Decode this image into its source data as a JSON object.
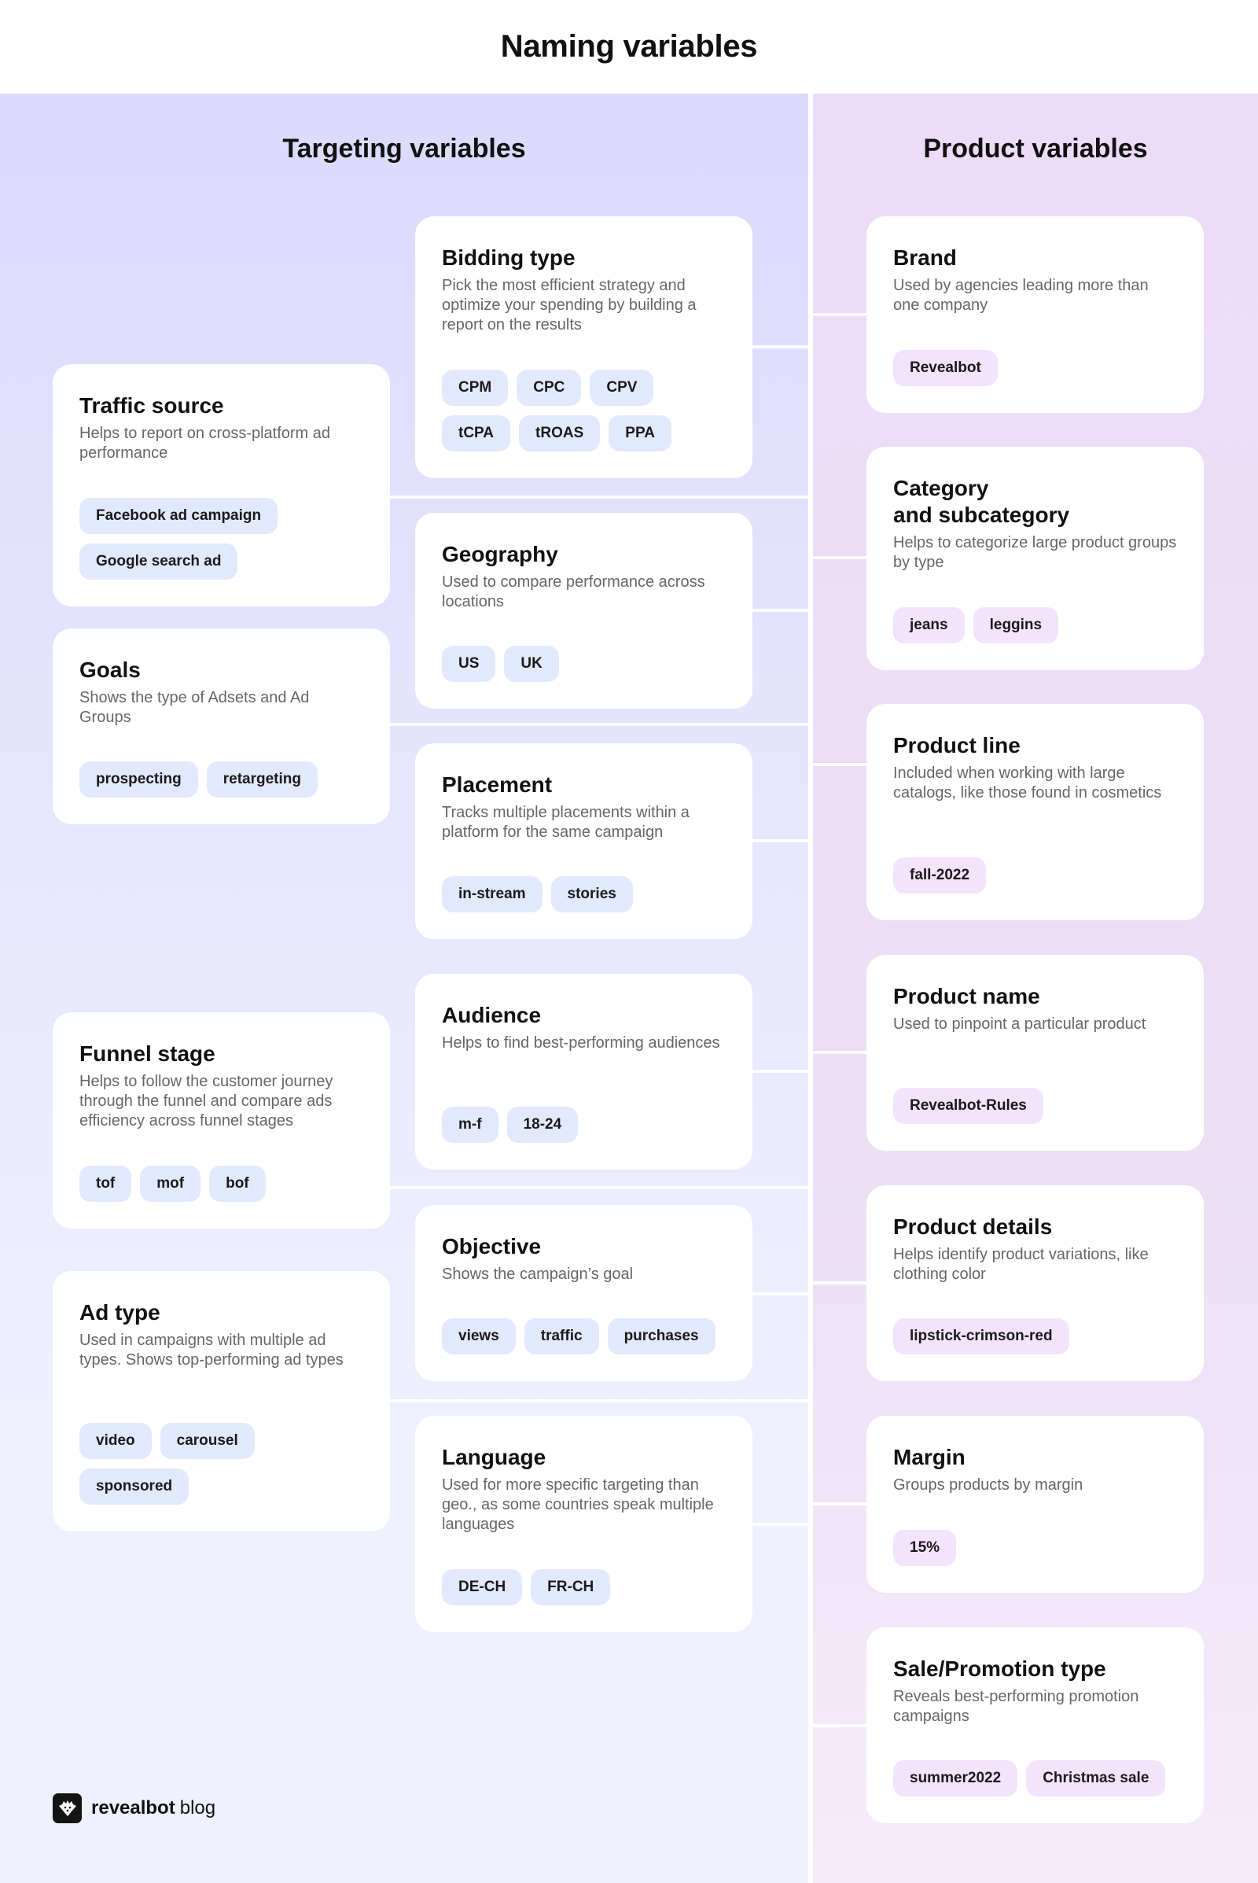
{
  "title": "Naming variables",
  "targeting": {
    "title": "Targeting variables",
    "cards": [
      {
        "title": "Bidding type",
        "desc": "Pick the most efficient strategy and optimize your spending by building a report on the results",
        "tags": [
          "CPM",
          "CPC",
          "CPV",
          "tCPA",
          "tROAS",
          "PPA"
        ]
      },
      {
        "title": "Traffic source",
        "desc": "Helps to report on cross-platform ad performance",
        "tags": [
          "Facebook ad campaign",
          "Google search ad"
        ]
      },
      {
        "title": "Geography",
        "desc": "Used to compare performance across locations",
        "tags": [
          "US",
          "UK"
        ]
      },
      {
        "title": "Goals",
        "desc": "Shows the type of Adsets and Ad Groups",
        "tags": [
          "prospecting",
          "retargeting"
        ]
      },
      {
        "title": "Placement",
        "desc": "Tracks multiple placements within a platform for the same campaign",
        "tags": [
          "in-stream",
          "stories"
        ]
      },
      {
        "title": "Audience",
        "desc": "Helps to find best-performing audiences",
        "tags": [
          "m-f",
          "18-24"
        ]
      },
      {
        "title": "Funnel stage",
        "desc": "Helps to follow the customer journey through the funnel and compare ads efficiency across funnel stages",
        "tags": [
          "tof",
          "mof",
          "bof"
        ]
      },
      {
        "title": "Objective",
        "desc": "Shows the campaign’s goal",
        "tags": [
          "views",
          "traffic",
          "purchases"
        ]
      },
      {
        "title": "Ad type",
        "desc": "Used in campaigns with multiple ad types. Shows top-performing ad types",
        "tags": [
          "video",
          "carousel",
          "sponsored"
        ]
      },
      {
        "title": "Language",
        "desc": "Used for more specific targeting than geo., as some countries speak multiple languages",
        "tags": [
          "DE-CH",
          "FR-CH"
        ]
      }
    ]
  },
  "product": {
    "title": "Product variables",
    "cards": [
      {
        "title": "Brand",
        "desc": "Used by agencies leading more than one company",
        "tags": [
          "Revealbot"
        ]
      },
      {
        "title": "Category\nand subcategory",
        "desc": "Helps to categorize large product groups by type",
        "tags": [
          "jeans",
          "leggins"
        ]
      },
      {
        "title": "Product line",
        "desc": "Included when working with large catalogs, like those found in cosmetics",
        "tags": [
          "fall-2022"
        ]
      },
      {
        "title": "Product name",
        "desc": "Used to pinpoint a particular product",
        "tags": [
          "Revealbot-Rules"
        ]
      },
      {
        "title": "Product details",
        "desc": "Helps identify product variations, like clothing color",
        "tags": [
          "lipstick-crimson-red"
        ]
      },
      {
        "title": "Margin",
        "desc": "Groups products by margin",
        "tags": [
          "15%"
        ]
      },
      {
        "title": "Sale/Promotion type",
        "desc": "Reveals best-performing promotion campaigns",
        "tags": [
          "summer2022",
          "Christmas sale"
        ]
      }
    ]
  },
  "footer": {
    "brand": "revealbot",
    "suffix": "blog"
  },
  "colors": {
    "targeting_tag": "#e3e9fc",
    "product_tag": "#f3e3fb",
    "left_bg": "#dcdafd",
    "right_bg": "#ecdcf9"
  }
}
